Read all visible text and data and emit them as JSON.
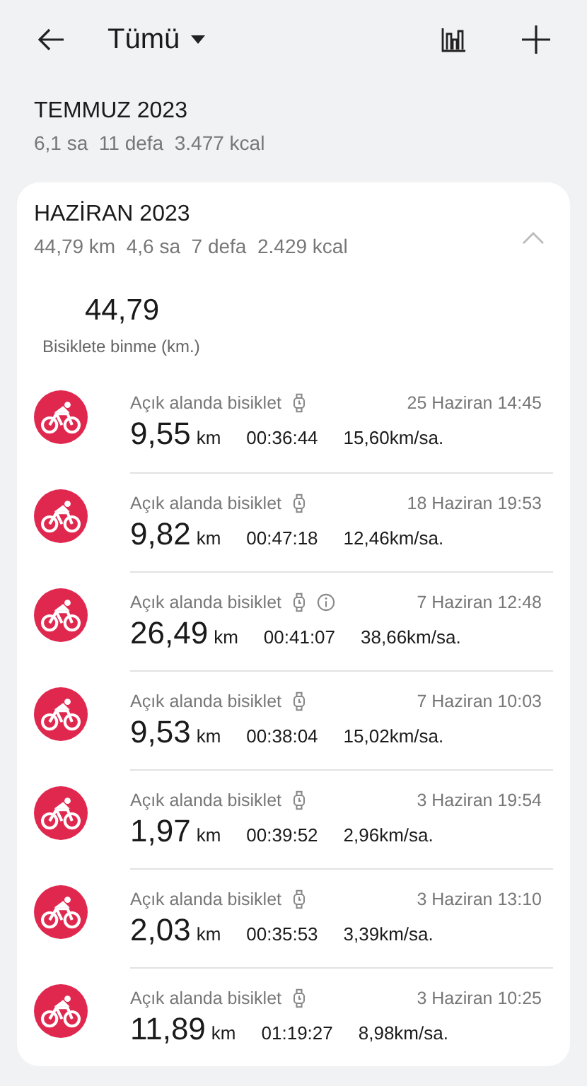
{
  "header": {
    "title": "Tümü"
  },
  "months": [
    {
      "title": "TEMMUZ 2023",
      "summary": "6,1 sa  11 defa  3.477 kcal",
      "expanded": false
    },
    {
      "title": "HAZİRAN 2023",
      "summary": "44,79 km  4,6 sa  7 defa  2.429 kcal",
      "expanded": true,
      "total": "44,79",
      "total_label": "Bisiklete binme (km.)",
      "activities": [
        {
          "name": "Açık alanda bisiklet",
          "info": false,
          "date": "25 Haziran 14:45",
          "distance": "9,55",
          "unit": "km",
          "duration": "00:36:44",
          "speed": "15,60km/sa."
        },
        {
          "name": "Açık alanda bisiklet",
          "info": false,
          "date": "18 Haziran 19:53",
          "distance": "9,82",
          "unit": "km",
          "duration": "00:47:18",
          "speed": "12,46km/sa."
        },
        {
          "name": "Açık alanda bisiklet",
          "info": true,
          "date": "7 Haziran 12:48",
          "distance": "26,49",
          "unit": "km",
          "duration": "00:41:07",
          "speed": "38,66km/sa."
        },
        {
          "name": "Açık alanda bisiklet",
          "info": false,
          "date": "7 Haziran 10:03",
          "distance": "9,53",
          "unit": "km",
          "duration": "00:38:04",
          "speed": "15,02km/sa."
        },
        {
          "name": "Açık alanda bisiklet",
          "info": false,
          "date": "3 Haziran 19:54",
          "distance": "1,97",
          "unit": "km",
          "duration": "00:39:52",
          "speed": "2,96km/sa."
        },
        {
          "name": "Açık alanda bisiklet",
          "info": false,
          "date": "3 Haziran 13:10",
          "distance": "2,03",
          "unit": "km",
          "duration": "00:35:53",
          "speed": "3,39km/sa."
        },
        {
          "name": "Açık alanda bisiklet",
          "info": false,
          "date": "3 Haziran 10:25",
          "distance": "11,89",
          "unit": "km",
          "duration": "01:19:27",
          "speed": "8,98km/sa."
        }
      ]
    }
  ]
}
